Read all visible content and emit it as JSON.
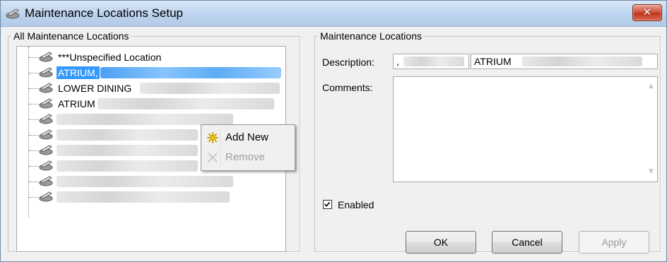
{
  "window": {
    "title": "Maintenance Locations Setup",
    "icon": "maintenance-tool-icon",
    "close_glyph": "✕"
  },
  "left_panel": {
    "legend": "All Maintenance Locations",
    "tree": {
      "node_icon": "maintenance-tool-icon",
      "items": [
        {
          "label": "***Unspecified Location",
          "selected": false
        },
        {
          "label": "ATRIUM,",
          "selected": true
        },
        {
          "label": "LOWER DINING",
          "selected": false
        },
        {
          "label": "ATRIUM",
          "selected": false
        },
        {
          "label": "",
          "selected": false
        },
        {
          "label": "",
          "selected": false
        },
        {
          "label": "",
          "selected": false
        },
        {
          "label": "",
          "selected": false
        },
        {
          "label": "",
          "selected": false
        },
        {
          "label": "",
          "selected": false
        }
      ]
    },
    "context_menu": {
      "items": [
        {
          "label": "Add New",
          "icon": "add-new-icon",
          "enabled": true
        },
        {
          "label": "Remove",
          "icon": "remove-icon",
          "enabled": false
        }
      ]
    }
  },
  "right_panel": {
    "legend": "Maintenance Locations",
    "description_label": "Description:",
    "description_code": ",",
    "description_value": "ATRIUM",
    "comments_label": "Comments:",
    "comments_value": "",
    "enabled_label": "Enabled",
    "enabled": true
  },
  "buttons": {
    "ok": "OK",
    "cancel": "Cancel",
    "apply": "Apply"
  },
  "colors": {
    "selection": "#3399ff",
    "close_button": "#c3321c",
    "title_bar": "#bcd3ee"
  }
}
